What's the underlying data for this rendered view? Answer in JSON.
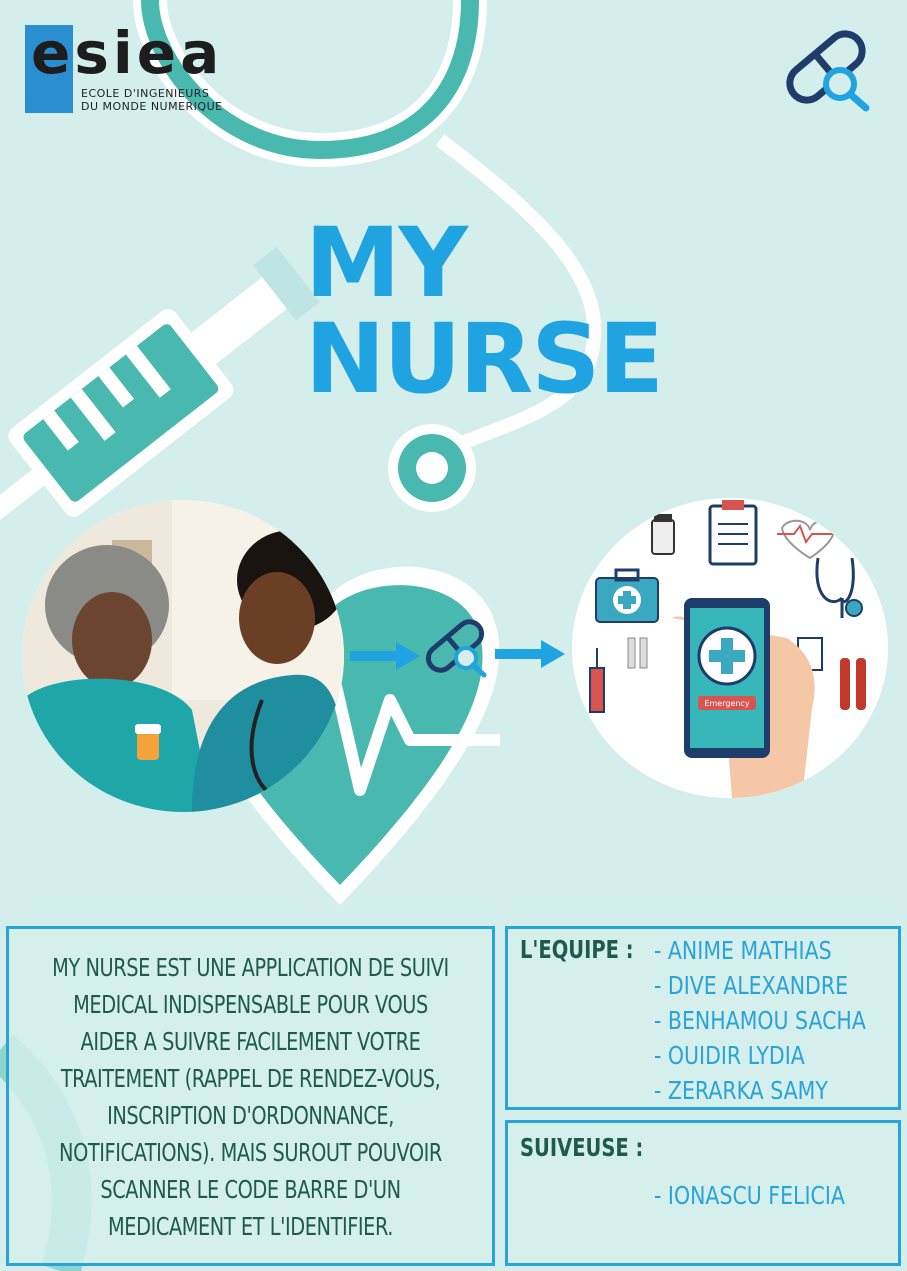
{
  "logo": {
    "word": "esiea",
    "line1": "ECOLE D'INGENIEURS",
    "line2": "DU MONDE NUMERIQUE"
  },
  "title": {
    "line1": "MY",
    "line2": "NURSE"
  },
  "description": "MY NURSE EST UNE APPLICATION DE SUIVI MEDICAL INDISPENSABLE POUR VOUS AIDER A SUIVRE FACILEMENT VOTRE TRAITEMENT (RAPPEL DE RENDEZ-VOUS, INSCRIPTION D'ORDONNANCE, NOTIFICATIONS). MAIS SUROUT POUVOIR SCANNER LE CODE BARRE D'UN MEDICAMENT ET L'IDENTIFIER.",
  "team": {
    "label": "L'EQUIPE :",
    "members": [
      "- ANIME MATHIAS",
      "- DIVE ALEXANDRE",
      "- BENHAMOU SACHA",
      "- OUIDIR LYDIA",
      "- ZERARKA SAMY"
    ]
  },
  "supervisor": {
    "label": "SUIVEUSE :",
    "name": "- IONASCU FELICIA"
  },
  "phone_banner": "Emergency",
  "colors": {
    "background": "#d4eeec",
    "teal": "#49b9b0",
    "blue": "#1fa3e1",
    "dark_green": "#1f5a4e",
    "navy": "#1f3d6b"
  }
}
